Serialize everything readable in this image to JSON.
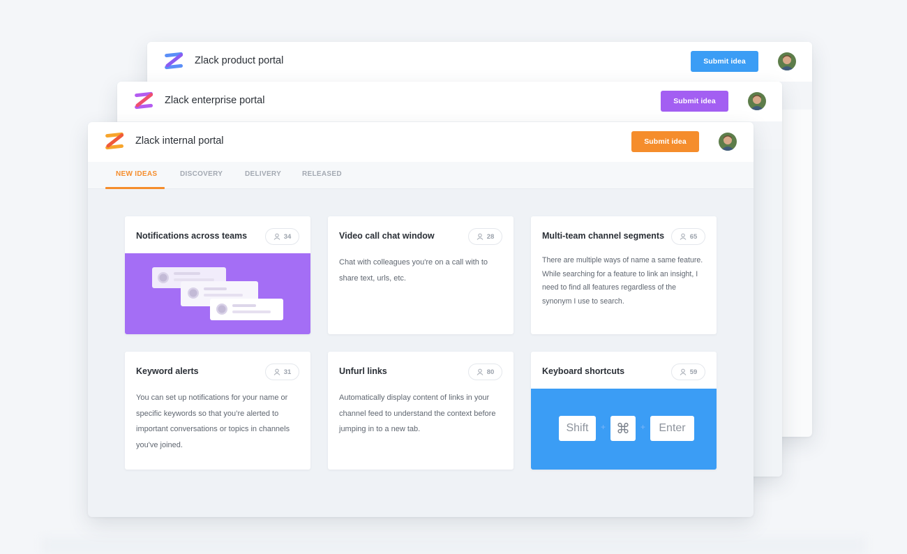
{
  "portals": {
    "product": {
      "title": "Zlack product portal",
      "submit_label": "Submit idea",
      "accent": "#3b9df5"
    },
    "enterprise": {
      "title": "Zlack enterprise portal",
      "submit_label": "Submit idea",
      "accent": "#a35ff2"
    },
    "internal": {
      "title": "Zlack internal portal",
      "submit_label": "Submit idea",
      "accent": "#f58d2c",
      "tabs": [
        {
          "label": "NEW IDEAS",
          "active": true
        },
        {
          "label": "DISCOVERY",
          "active": false
        },
        {
          "label": "DELIVERY",
          "active": false
        },
        {
          "label": "RELEASED",
          "active": false
        }
      ],
      "cards": [
        {
          "title": "Notifications across teams",
          "votes": "34",
          "media": "notification-stack-illustration",
          "media_color": "#a46ef5"
        },
        {
          "title": "Video call chat window",
          "votes": "28",
          "description": "Chat with colleagues you're on a call with to share text, urls, etc."
        },
        {
          "title": "Multi-team channel segments",
          "votes": "65",
          "description": "There are multiple ways of name a same feature. While searching for a feature to link an insight, I need to find all features regardless of the synonym I use to search."
        },
        {
          "title": "Keyword alerts",
          "votes": "31",
          "description": "You can set up notifications for your name or specific keywords so that you’re alerted to important conversations or topics in channels you've joined."
        },
        {
          "title": "Unfurl links",
          "votes": "80",
          "description": "Automatically display content of links in your channel feed to understand the context before jumping in to a new tab."
        },
        {
          "title": "Keyboard shortcuts",
          "votes": "59",
          "media": "keyboard-keys-illustration",
          "media_color": "#3b9df5",
          "keys": {
            "shift": "Shift",
            "cmd": "⌘",
            "enter": "Enter",
            "plus": "+"
          }
        }
      ]
    }
  },
  "icons": {
    "logo": "zlack-logo-icon",
    "vote": "user-icon",
    "avatar": "user-avatar"
  }
}
